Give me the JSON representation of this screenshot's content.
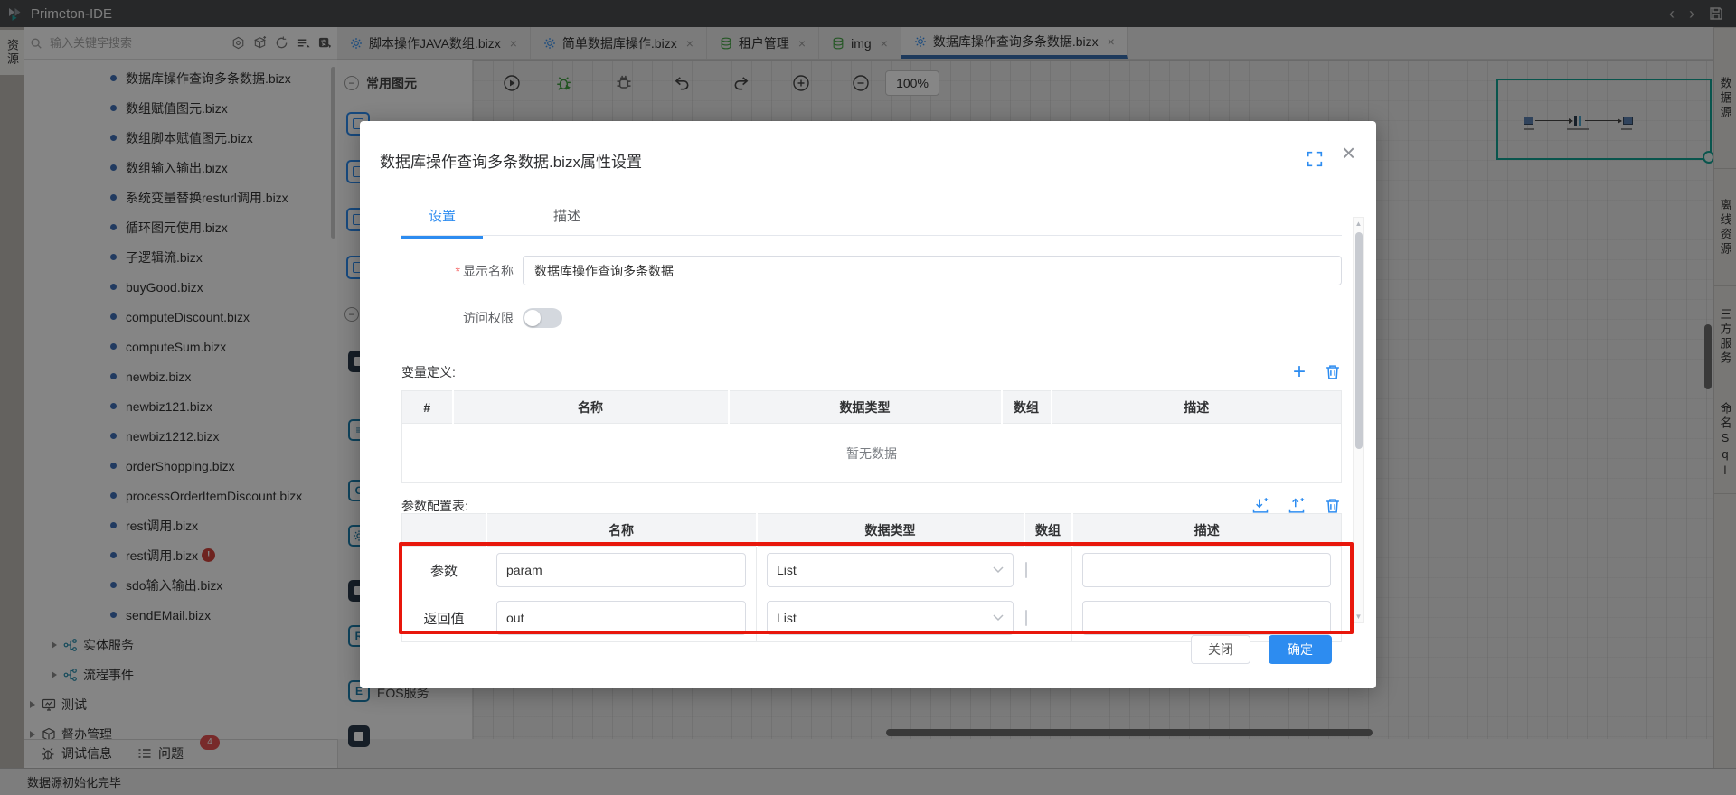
{
  "colors": {
    "accent": "#2d8cf0",
    "tab_underline": "#3a6fae",
    "annotation_red": "#e8170c",
    "badge_red": "#e25050",
    "minimap_teal": "#12a091",
    "db_green": "#47a447"
  },
  "title_bar": {
    "app_title": "Primeton-IDE"
  },
  "left_strip": {
    "items": [
      {
        "label": "资源"
      }
    ]
  },
  "explorer": {
    "search": {
      "placeholder": "输入关键字搜索"
    },
    "files": [
      {
        "label": "数据库操作查询多条数据.bizx"
      },
      {
        "label": "数组赋值图元.bizx"
      },
      {
        "label": "数组脚本赋值图元.bizx"
      },
      {
        "label": "数组输入输出.bizx"
      },
      {
        "label": "系统变量替换resturl调用.bizx"
      },
      {
        "label": "循环图元使用.bizx"
      },
      {
        "label": "子逻辑流.bizx"
      },
      {
        "label": "buyGood.bizx"
      },
      {
        "label": "computeDiscount.bizx"
      },
      {
        "label": "computeSum.bizx"
      },
      {
        "label": "newbiz.bizx"
      },
      {
        "label": "newbiz121.bizx"
      },
      {
        "label": "newbiz1212.bizx"
      },
      {
        "label": "orderShopping.bizx"
      },
      {
        "label": "processOrderItemDiscount.bizx"
      },
      {
        "label": "rest调用.bizx"
      },
      {
        "label": "rest调用.bizx",
        "badge": "!"
      },
      {
        "label": "sdo输入输出.bizx"
      },
      {
        "label": "sendEMail.bizx"
      }
    ],
    "folders": [
      {
        "label": "实体服务"
      },
      {
        "label": "流程事件"
      }
    ],
    "roots": [
      {
        "label": "测试"
      },
      {
        "label": "督办管理"
      }
    ],
    "bottom_tabs": [
      {
        "label": "调试信息"
      },
      {
        "label": "问题",
        "badge": "4"
      }
    ]
  },
  "editor_tabs": [
    {
      "label": "脚本操作JAVA数组.bizx",
      "icon": "gear"
    },
    {
      "label": "简单数据库操作.bizx",
      "icon": "gear"
    },
    {
      "label": "租户管理",
      "icon": "database"
    },
    {
      "label": "img",
      "icon": "database"
    },
    {
      "label": "数据库操作查询多条数据.bizx",
      "icon": "gear",
      "active": true
    }
  ],
  "toolbar": {
    "zoom_level": "100%"
  },
  "palette": {
    "section_title": "常用图元",
    "eos_item": "EOS服务"
  },
  "right_strip": {
    "items": [
      {
        "label": "数据源"
      },
      {
        "label": "离线资源"
      },
      {
        "label": "三方服务"
      },
      {
        "label": "命名Sql"
      }
    ]
  },
  "modal": {
    "title": "数据库操作查询多条数据.bizx属性设置",
    "tabs": [
      {
        "label": "设置"
      },
      {
        "label": "描述"
      }
    ],
    "required_marker": "*",
    "display_name": {
      "label": "显示名称",
      "value": "数据库操作查询多条数据"
    },
    "access": {
      "label": "访问权限",
      "enabled": false
    },
    "variables": {
      "title": "变量定义:",
      "columns": [
        "#",
        "名称",
        "数据类型",
        "数组",
        "描述"
      ],
      "empty_text": "暂无数据"
    },
    "params": {
      "title": "参数配置表:",
      "columns": [
        "名称",
        "数据类型",
        "数组",
        "描述"
      ],
      "rows": [
        {
          "row_label": "参数",
          "name": "param",
          "type": "List",
          "array_checked": false,
          "description": ""
        },
        {
          "row_label": "返回值",
          "name": "out",
          "type": "List",
          "array_checked": false,
          "description": ""
        }
      ]
    },
    "footer": {
      "close_label": "关闭",
      "ok_label": "确定"
    }
  },
  "status_bar": {
    "text": "数据源初始化完毕"
  }
}
